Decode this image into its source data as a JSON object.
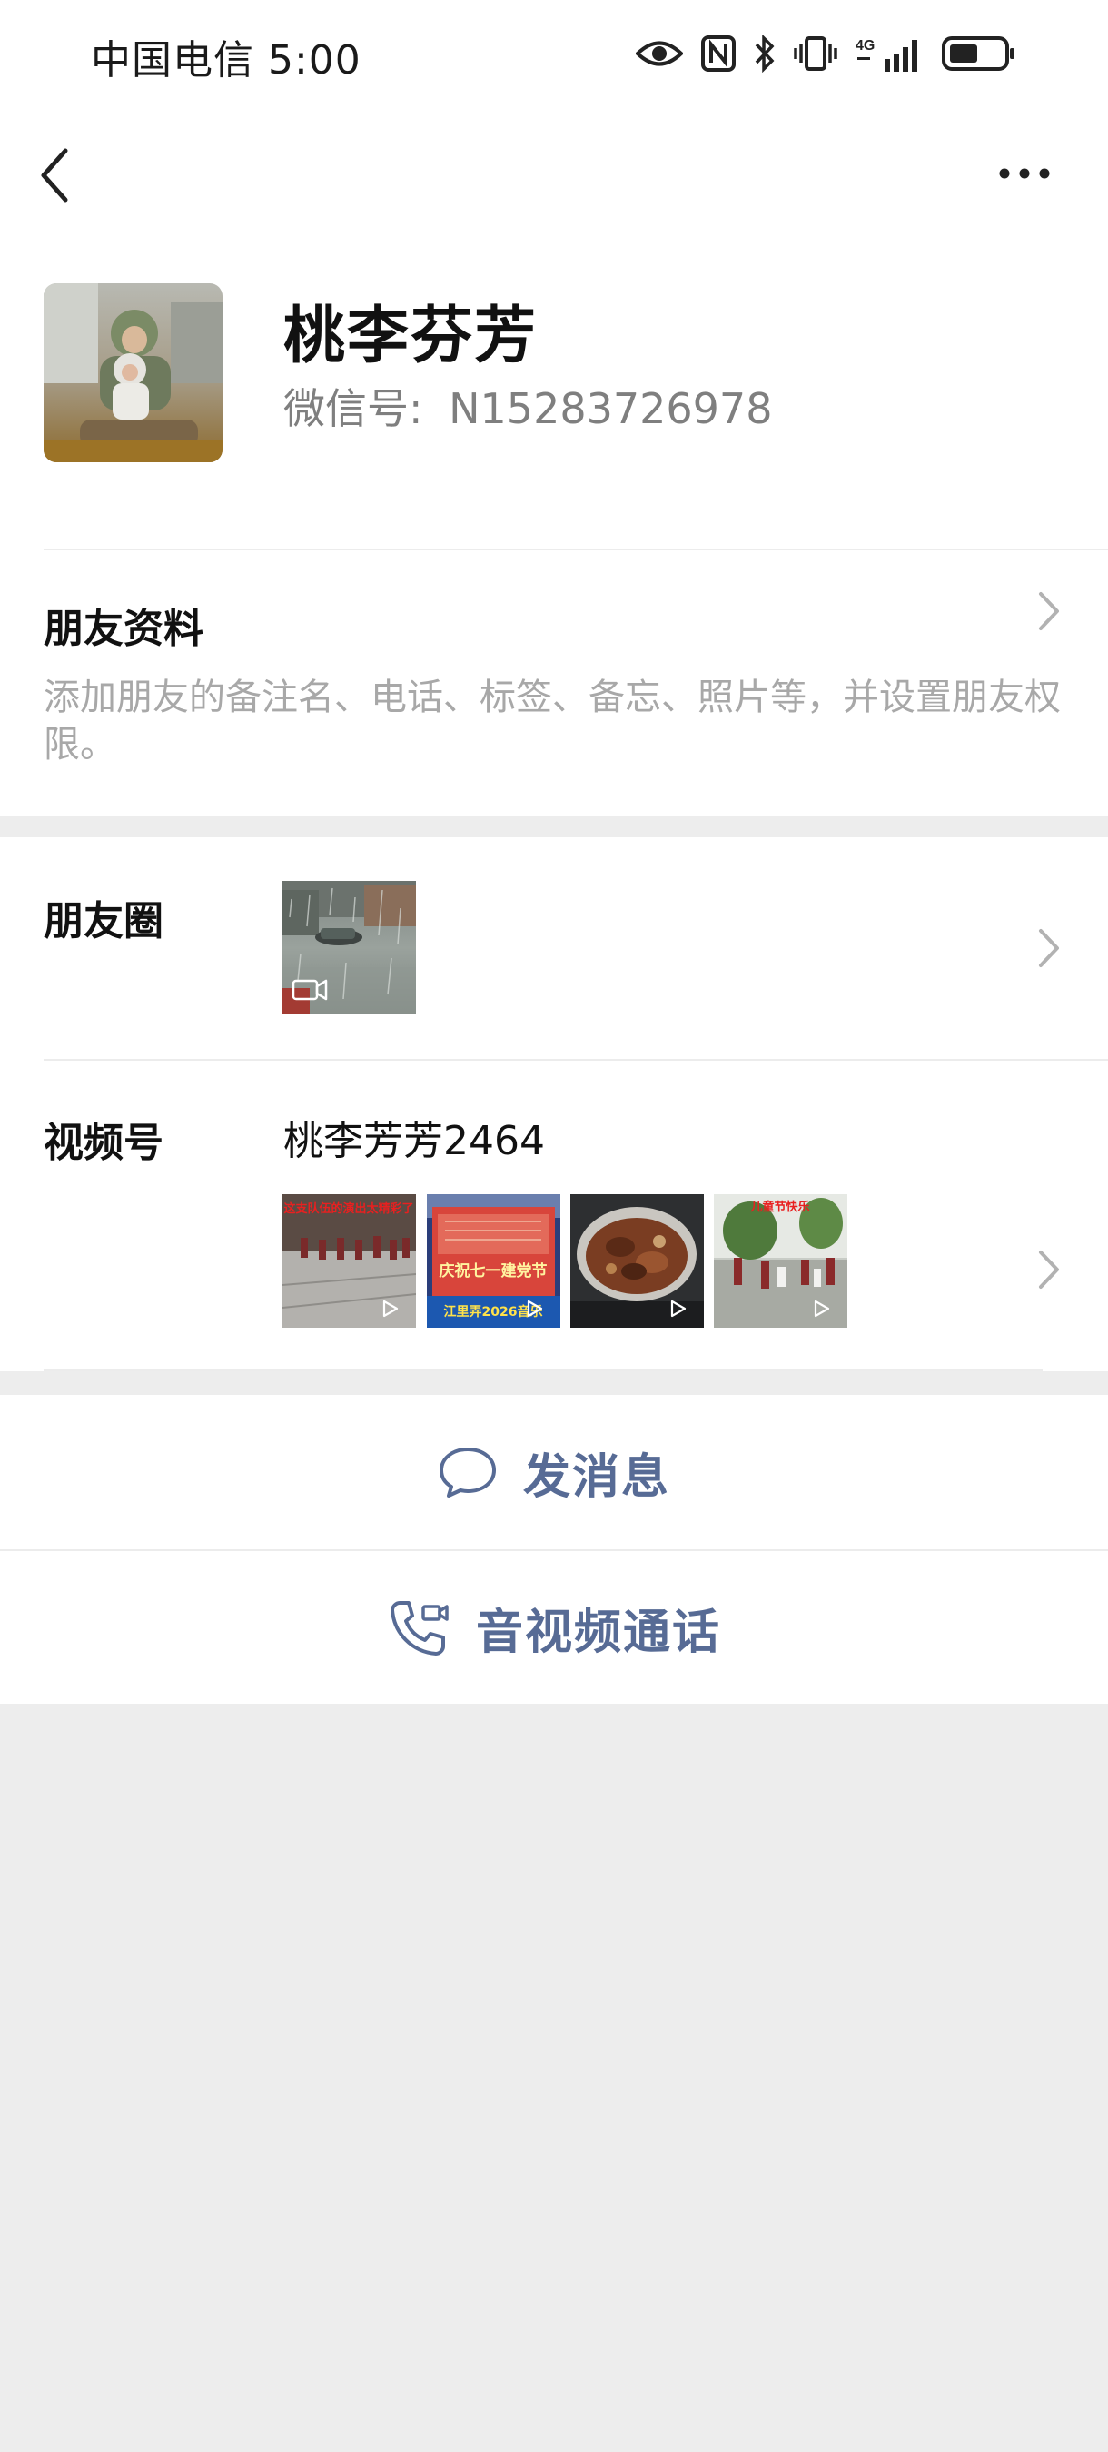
{
  "status_bar": {
    "carrier_time": "中国电信 5:00",
    "network": "4G",
    "icons": [
      "eye-icon",
      "nfc-icon",
      "bluetooth-icon",
      "vibrate-icon",
      "signal-icon",
      "battery-icon"
    ]
  },
  "nav": {
    "back_icon": "back-arrow-icon",
    "more_icon": "more-dots-icon"
  },
  "profile": {
    "nickname": "桃李芬芳",
    "wxid_label": "微信号:",
    "wxid_value": "N15283726978"
  },
  "friend_info": {
    "title": "朋友资料",
    "description": "添加朋友的备注名、电话、标签、备忘、照片等，并设置朋友权限。"
  },
  "moments": {
    "label": "朋友圈",
    "thumbnail_badge": "video-camera-icon"
  },
  "channels": {
    "label": "视频号",
    "name": "桃李芳芳2464",
    "thumbnails": [
      {
        "caption": "这支队伍的演出太精彩了",
        "badge": "play-icon"
      },
      {
        "caption": "庆祝七一建党节",
        "caption2": "江里弄2026音乐",
        "badge": "play-icon"
      },
      {
        "caption": "",
        "badge": "play-icon"
      },
      {
        "caption": "儿童节快乐",
        "badge": "play-icon"
      }
    ]
  },
  "actions": {
    "message_label": "发消息",
    "call_label": "音视频通话"
  },
  "colors": {
    "accent": "#576b95",
    "background": "#ededed",
    "muted_text": "#a8a8a8"
  }
}
